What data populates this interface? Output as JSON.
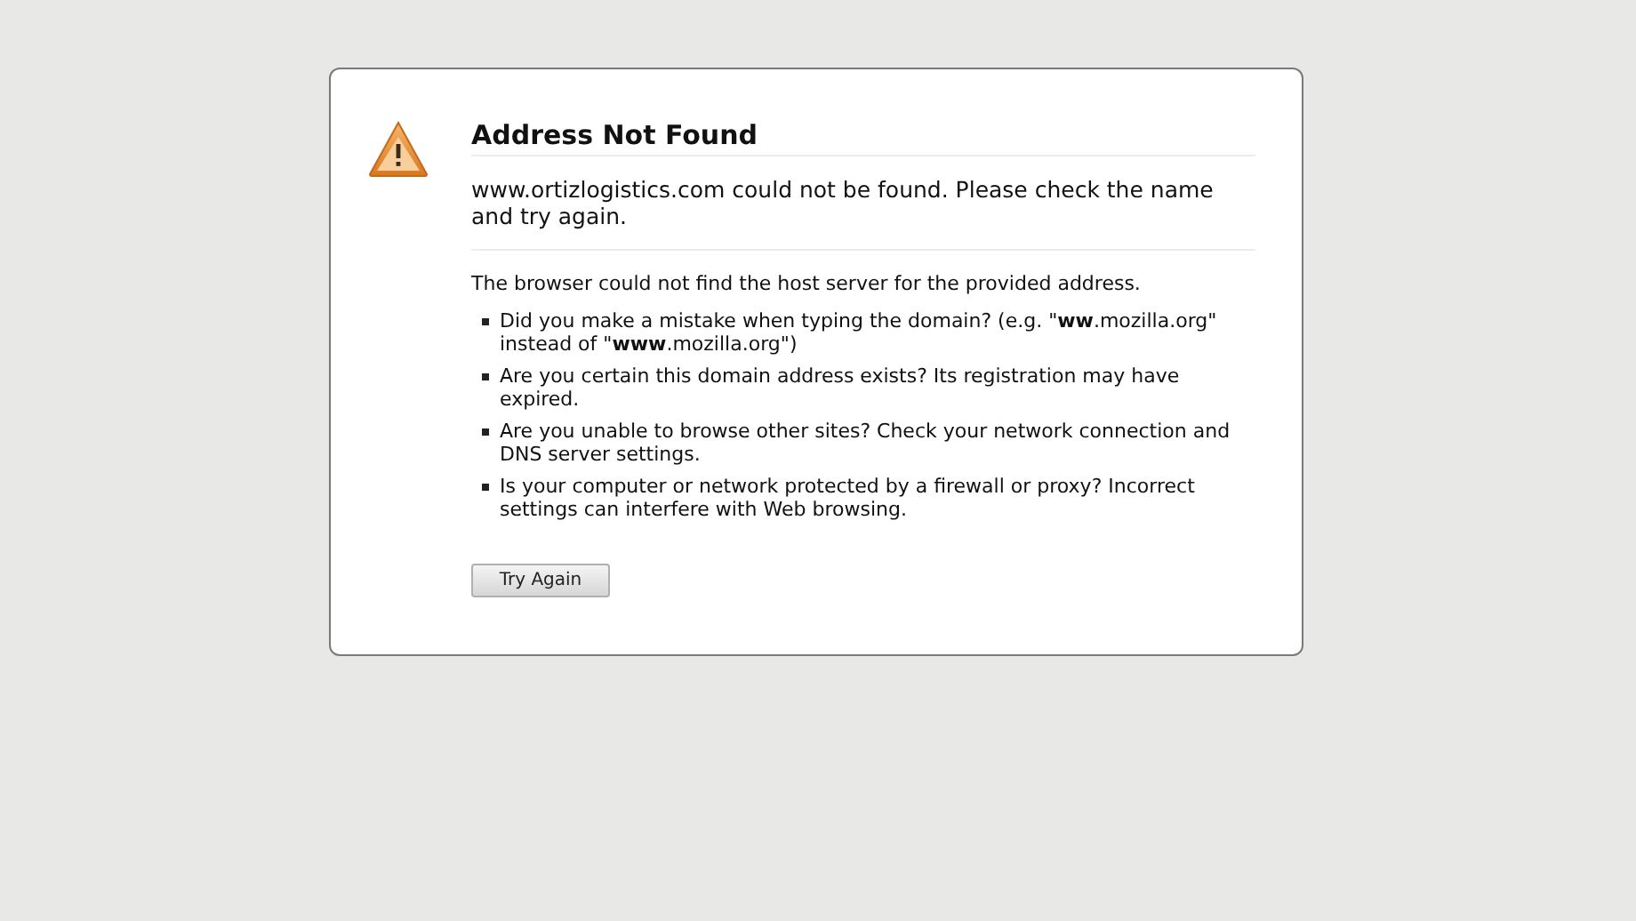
{
  "error_page": {
    "title": "Address Not Found",
    "short_description": "www.ortizlogistics.com could not be found. Please check the name and try again.",
    "intro": "The browser could not find the host server for the provided address.",
    "suggestions": [
      "Did you make a mistake when typing the domain? (e.g. \"**ww**.mozilla.org\" instead of \"**www**.mozilla.org\")",
      "Are you certain this domain address exists? Its registration may have expired.",
      "Are you unable to browse other sites? Check your network connection and DNS server settings.",
      "Is your computer or network protected by a firewall or proxy? Incorrect settings can interfere with Web browsing."
    ],
    "button": "Try Again"
  }
}
